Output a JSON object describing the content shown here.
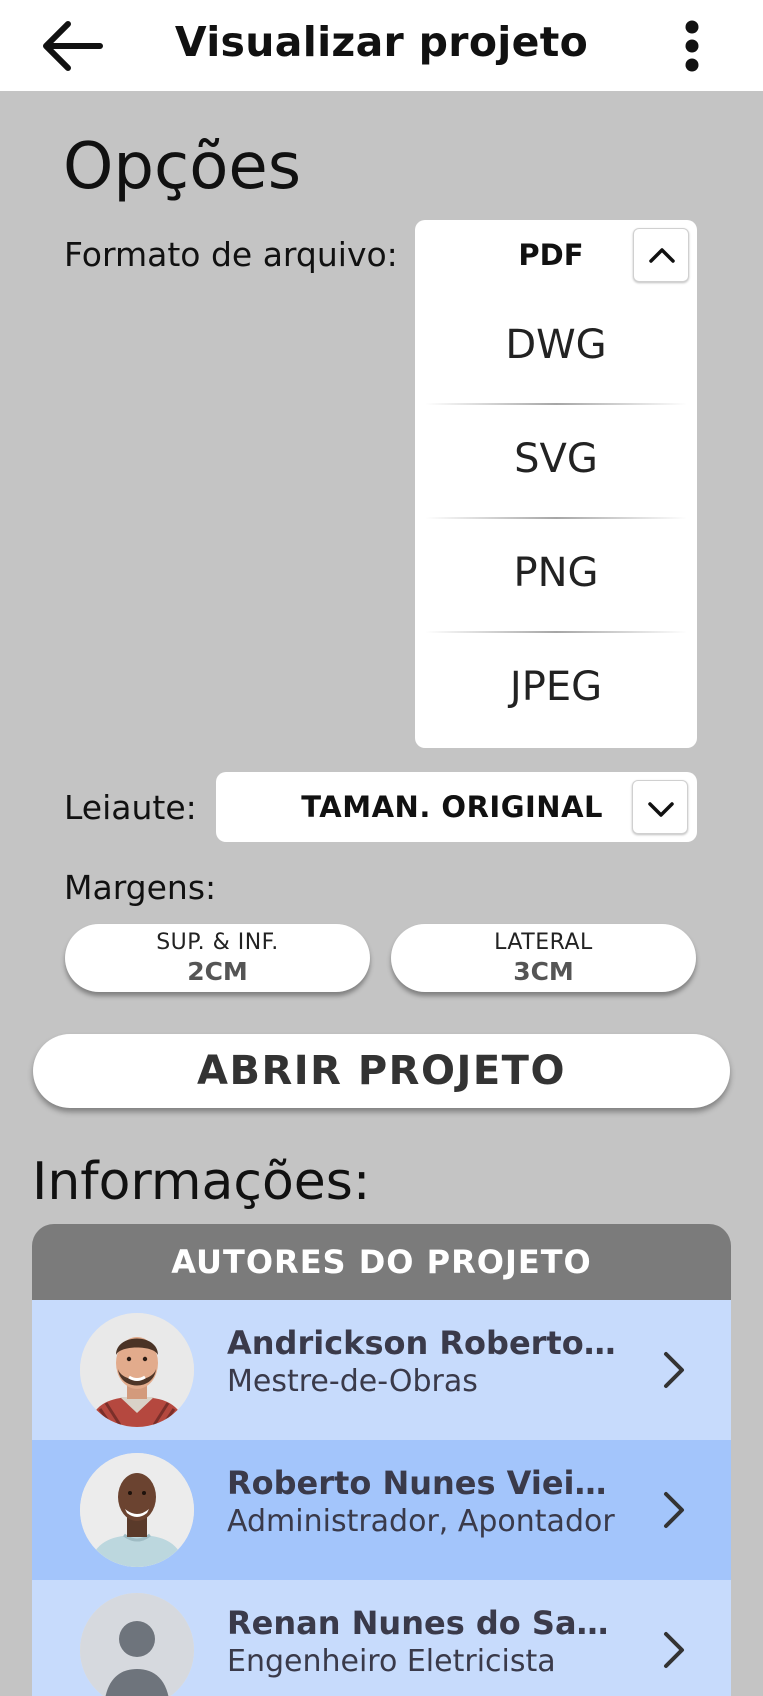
{
  "header": {
    "title": "Visualizar projeto",
    "back_icon": "arrow-left-icon",
    "menu_icon": "more-vertical-icon"
  },
  "options": {
    "title": "Opções",
    "format_label": "Formato de arquivo:",
    "format_selected": "PDF",
    "format_options": [
      "DWG",
      "SVG",
      "PNG",
      "JPEG"
    ],
    "layout_label": "Leiaute:",
    "layout_value": "TAMAN. ORIGINAL",
    "margins_label": "Margens:",
    "margins": [
      {
        "label": "SUP. & INF.",
        "value": "2CM"
      },
      {
        "label": "LATERAL",
        "value": "3CM"
      }
    ],
    "open_button": "ABRIR PROJETO"
  },
  "info": {
    "title": "Informações:",
    "authors_header": "AUTORES DO PROJETO",
    "authors": [
      {
        "name": "Andrickson Roberto Da...",
        "role": "Mestre-de-Obras"
      },
      {
        "name": "Roberto Nunes Vieira d...",
        "role": "Administrador, Apontador"
      },
      {
        "name": "Renan Nunes do Santos",
        "role": "Engenheiro Eletricista"
      }
    ]
  },
  "colors": {
    "background": "#c4c4c4",
    "header_bar": "#7b7b7b",
    "row_light": "#c7dbfc",
    "row_highlight": "#a3c5fb"
  }
}
